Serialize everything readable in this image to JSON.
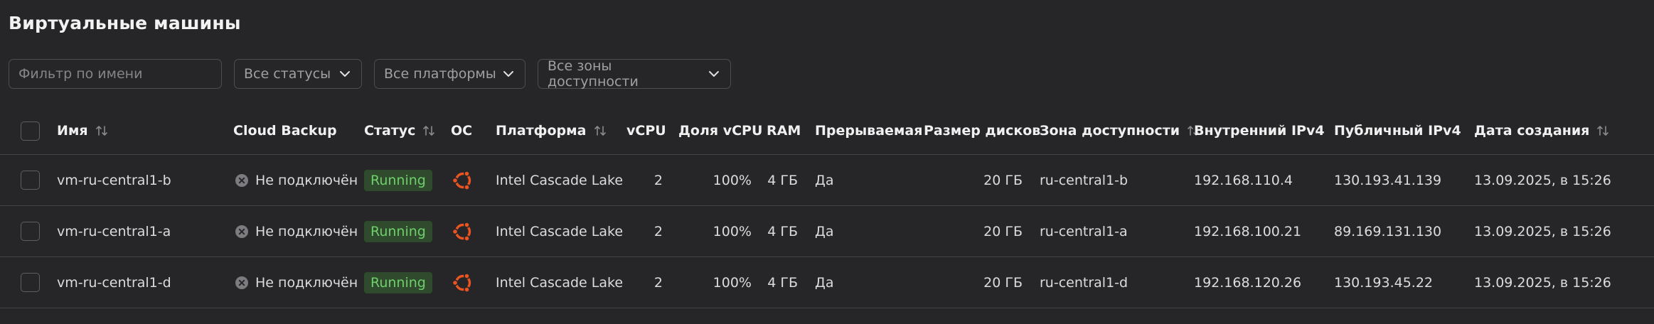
{
  "page": {
    "title": "Виртуальные машины"
  },
  "filters": {
    "name_placeholder": "Фильтр по имени",
    "status_label": "Все статусы",
    "platform_label": "Все платформы",
    "zone_label": "Все зоны доступности"
  },
  "table": {
    "columns": {
      "name": "Имя",
      "backup": "Cloud Backup",
      "status": "Статус",
      "os": "ОС",
      "platform": "Платформа",
      "vcpu": "vCPU",
      "vcpu_share": "Доля vCPU",
      "ram": "RAM",
      "preemptible": "Прерываемая",
      "disk_size": "Размер дисков",
      "zone": "Зона доступности",
      "internal_ip": "Внутренний IPv4",
      "public_ip": "Публичный IPv4",
      "created": "Дата создания"
    },
    "rows": [
      {
        "name": "vm-ru-central1-b",
        "backup": "Не подключён",
        "status": "Running",
        "os_icon": "ubuntu-icon",
        "platform": "Intel Cascade Lake",
        "vcpu": "2",
        "vcpu_share": "100%",
        "ram": "4 ГБ",
        "preemptible": "Да",
        "disk_size": "20 ГБ",
        "zone": "ru-central1-b",
        "internal_ip": "192.168.110.4",
        "public_ip": "130.193.41.139",
        "created": "13.09.2025, в 15:26"
      },
      {
        "name": "vm-ru-central1-a",
        "backup": "Не подключён",
        "status": "Running",
        "os_icon": "ubuntu-icon",
        "platform": "Intel Cascade Lake",
        "vcpu": "2",
        "vcpu_share": "100%",
        "ram": "4 ГБ",
        "preemptible": "Да",
        "disk_size": "20 ГБ",
        "zone": "ru-central1-a",
        "internal_ip": "192.168.100.21",
        "public_ip": "89.169.131.130",
        "created": "13.09.2025, в 15:26"
      },
      {
        "name": "vm-ru-central1-d",
        "backup": "Не подключён",
        "status": "Running",
        "os_icon": "ubuntu-icon",
        "platform": "Intel Cascade Lake",
        "vcpu": "2",
        "vcpu_share": "100%",
        "ram": "4 ГБ",
        "preemptible": "Да",
        "disk_size": "20 ГБ",
        "zone": "ru-central1-d",
        "internal_ip": "192.168.120.26",
        "public_ip": "130.193.45.22",
        "created": "13.09.2025, в 15:26"
      }
    ]
  },
  "colors": {
    "background": "#262629",
    "status_running_text": "#6fcf6a",
    "status_running_bg": "#2f4a2d",
    "ubuntu_orange": "#e95420"
  }
}
